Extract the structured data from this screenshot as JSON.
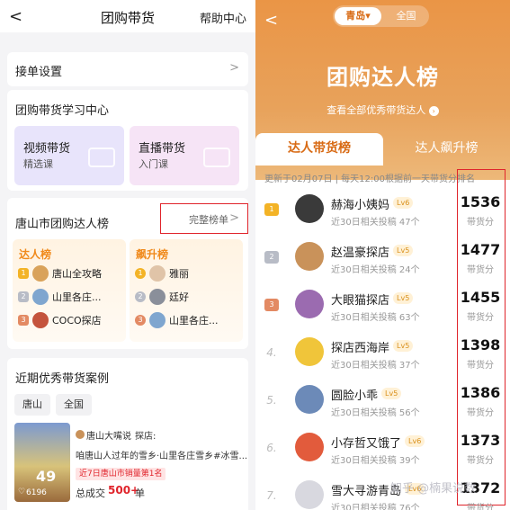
{
  "left": {
    "header": {
      "title": "团购带货",
      "help": "帮助中心",
      "back": "<"
    },
    "settings": {
      "label": "接单设置",
      "chevron": ">"
    },
    "learning": {
      "title": "团购带货学习中心",
      "cards": [
        {
          "title": "视频带货",
          "sub": "精选课",
          "icon": "video-camera-icon",
          "color": "#e8e4fb"
        },
        {
          "title": "直播带货",
          "sub": "入门课",
          "icon": "tv-icon",
          "color": "#f6e4f6"
        }
      ]
    },
    "ranking": {
      "title": "唐山市团购达人榜",
      "full_link": "完整榜单",
      "chevron": ">",
      "talent": {
        "header": "达人榜",
        "items": [
          {
            "rank": "1",
            "name": "唐山全攻略"
          },
          {
            "rank": "2",
            "name": "山里各庄..."
          },
          {
            "rank": "3",
            "name": "COCO探店"
          }
        ]
      },
      "rising": {
        "header": "飙升榜",
        "items": [
          {
            "rank": "1",
            "name": "雅丽"
          },
          {
            "rank": "2",
            "name": "廷好"
          },
          {
            "rank": "3",
            "name": "山里各庄..."
          }
        ]
      }
    },
    "cases": {
      "title": "近期优秀带货案例",
      "tags": [
        "唐山",
        "全国"
      ],
      "item": {
        "author": "唐山大嘴说",
        "author_suffix": "探店:",
        "desc": "咱唐山人过年的雪乡·山里各庄雪乡#冰雪...",
        "badge": "近7日唐山市销量第1名",
        "total_prefix": "总成交",
        "total_value": "500+",
        "total_unit": "单",
        "likes": "6196",
        "thumb_price": "49"
      }
    }
  },
  "right": {
    "back": "<",
    "city_toggle": {
      "selected": "青岛▾",
      "other": "全国"
    },
    "title": "团购达人榜",
    "subtitle": "查看全部优秀带货达人",
    "tabs": [
      "达人带货榜",
      "达人飙升榜"
    ],
    "notice": "更新于02月07日 | 每天12:00根据前一天带货分排名",
    "rows": [
      {
        "rank": "1",
        "name": "赫海小姨妈",
        "level": "Lv6",
        "meta": "近30日相关投稿 47个",
        "score": "1536",
        "unit": "带货分"
      },
      {
        "rank": "2",
        "name": "赵温豪探店",
        "level": "Lv5",
        "meta": "近30日相关投稿 24个",
        "score": "1477",
        "unit": "带货分"
      },
      {
        "rank": "3",
        "name": "大眼猫探店",
        "level": "Lv5",
        "meta": "近30日相关投稿 63个",
        "score": "1455",
        "unit": "带货分"
      },
      {
        "rank": "4.",
        "name": "探店西海岸",
        "level": "Lv5",
        "meta": "近30日相关投稿 37个",
        "score": "1398",
        "unit": "带货分"
      },
      {
        "rank": "5.",
        "name": "圆脸小乖",
        "level": "Lv5",
        "meta": "近30日相关投稿 56个",
        "score": "1386",
        "unit": "带货分"
      },
      {
        "rank": "6.",
        "name": "小存哲又饿了",
        "level": "Lv6",
        "meta": "近30日相关投稿 39个",
        "score": "1373",
        "unit": "带货分"
      },
      {
        "rank": "7.",
        "name": "雪大寻游青岛",
        "level": "Lv6",
        "meta": "近30日相关投稿 76个",
        "score": "1372",
        "unit": "带货分"
      }
    ],
    "watermark": "知乎 @楠果说数"
  },
  "colors": {
    "accent_orange": "#e8913e",
    "highlight_red": "#e0242b",
    "gold": "#f3b326",
    "silver": "#b8bcc6",
    "bronze": "#e38a63"
  }
}
